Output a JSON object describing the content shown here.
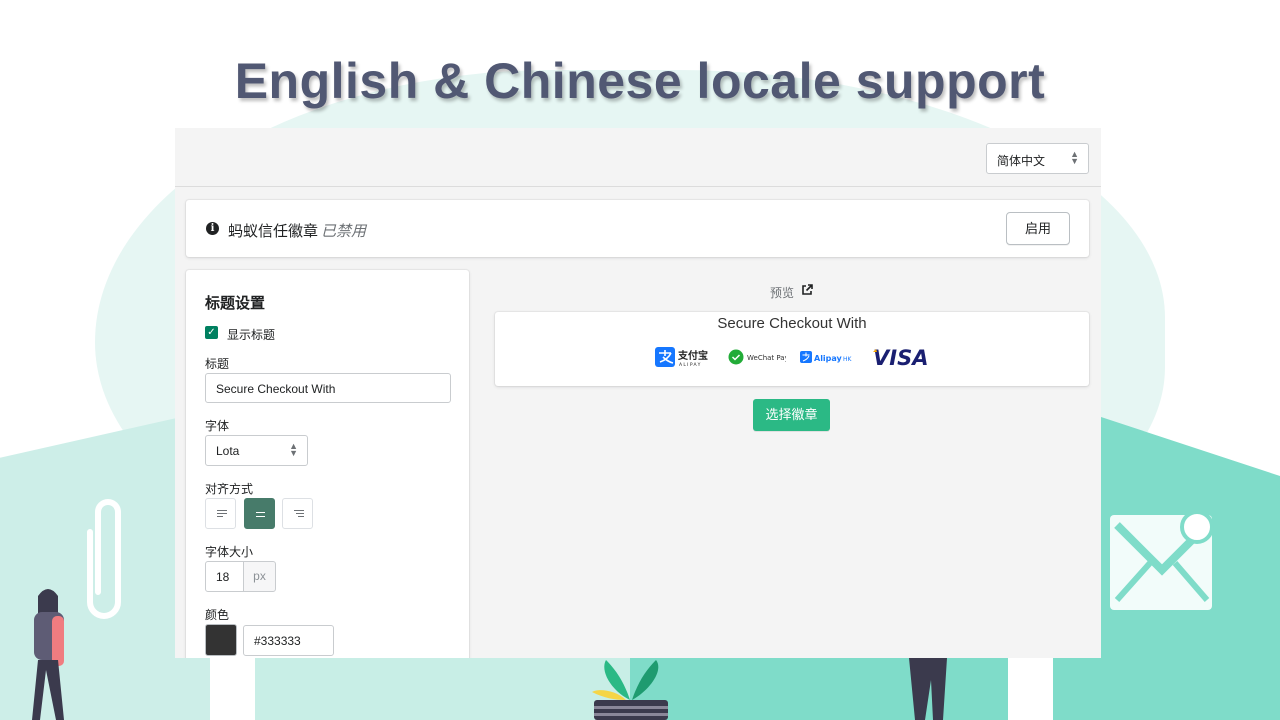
{
  "hero": {
    "title": "English & Chinese locale support"
  },
  "topbar": {
    "locale_value": "简体中文"
  },
  "status": {
    "app_name": "蚂蚁信任徽章",
    "state": "已禁用",
    "enable_label": "启用"
  },
  "settings": {
    "section_title": "标题设置",
    "show_title_label": "显示标题",
    "show_title_checked": true,
    "title_label": "标题",
    "title_value": "Secure Checkout With",
    "font_label": "字体",
    "font_value": "Lota",
    "align_label": "对齐方式",
    "align_selected": "center",
    "size_label": "字体大小",
    "size_value": "18",
    "size_unit": "px",
    "color_label": "颜色",
    "color_value": "#333333"
  },
  "preview": {
    "label": "预览",
    "heading": "Secure Checkout With",
    "badges": [
      "alipay-badge",
      "wechat-pay-badge",
      "alipay-hk-badge",
      "visa-badge"
    ],
    "select_badge_label": "选择徽章"
  },
  "colors": {
    "primary": "#2bb985",
    "active_align": "#477b6a",
    "checkbox": "#008060",
    "title_text": "#515873",
    "bg_mint": "#7fdcc9"
  }
}
